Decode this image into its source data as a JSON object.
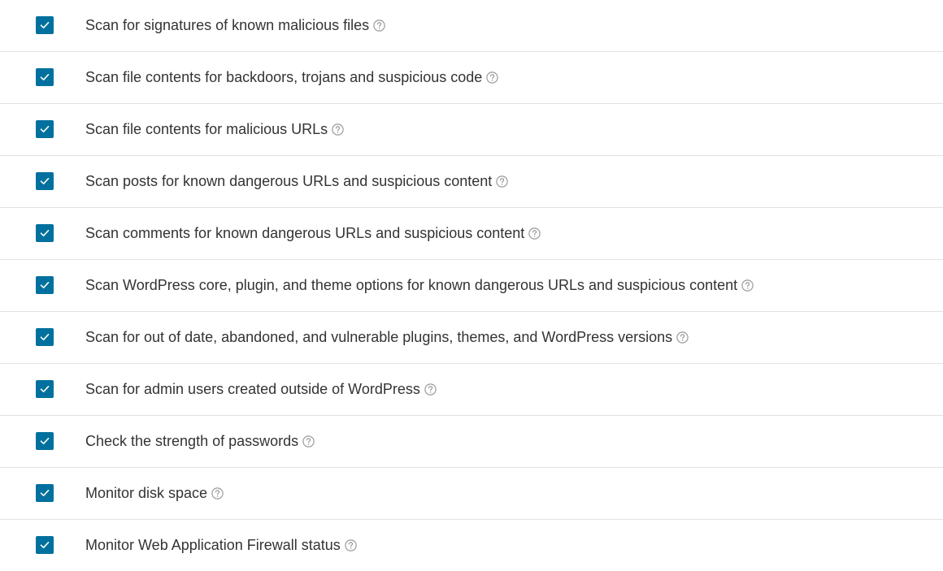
{
  "colors": {
    "checkbox_fill": "#00709e",
    "checkmark": "#ffffff",
    "help_icon": "#9a9a9a",
    "divider": "#e2e2e2"
  },
  "icons": {
    "checkbox": "check-icon",
    "help": "question-circle-icon"
  },
  "options": [
    {
      "label": "Scan for signatures of known malicious files",
      "checked": true
    },
    {
      "label": "Scan file contents for backdoors, trojans and suspicious code",
      "checked": true
    },
    {
      "label": "Scan file contents for malicious URLs",
      "checked": true
    },
    {
      "label": "Scan posts for known dangerous URLs and suspicious content",
      "checked": true
    },
    {
      "label": "Scan comments for known dangerous URLs and suspicious content",
      "checked": true
    },
    {
      "label": "Scan WordPress core, plugin, and theme options for known dangerous URLs and suspicious content",
      "checked": true
    },
    {
      "label": "Scan for out of date, abandoned, and vulnerable plugins, themes, and WordPress versions",
      "checked": true
    },
    {
      "label": "Scan for admin users created outside of WordPress",
      "checked": true
    },
    {
      "label": "Check the strength of passwords",
      "checked": true
    },
    {
      "label": "Monitor disk space",
      "checked": true
    },
    {
      "label": "Monitor Web Application Firewall status",
      "checked": true
    }
  ]
}
